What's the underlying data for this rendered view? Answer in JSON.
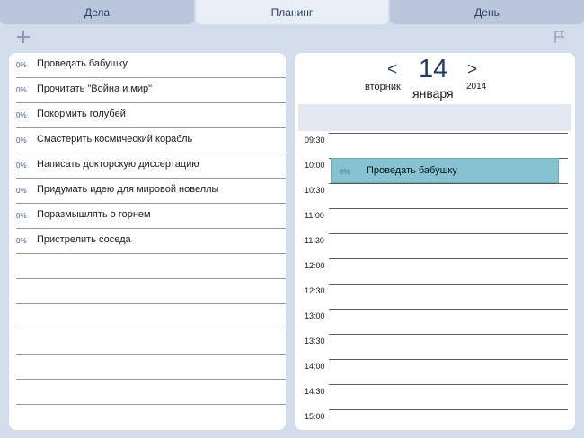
{
  "tabs": [
    {
      "label": "Дела"
    },
    {
      "label": "Планинг"
    },
    {
      "label": "День"
    }
  ],
  "tasks": [
    {
      "percent": "0%",
      "title": "Проведать бабушку"
    },
    {
      "percent": "0%",
      "title": "Прочитать \"Война и мир\""
    },
    {
      "percent": "0%",
      "title": "Покормить голубей"
    },
    {
      "percent": "0%",
      "title": "Смастерить космический корабль"
    },
    {
      "percent": "0%",
      "title": "Написать докторскую диссертацию"
    },
    {
      "percent": "0%",
      "title": "Придумать идею для мировой новеллы"
    },
    {
      "percent": "0%",
      "title": "Поразмышлять о горнем"
    },
    {
      "percent": "0%",
      "title": "Пристрелить соседа"
    }
  ],
  "calendar": {
    "prev": "<",
    "next": ">",
    "day": "14",
    "weekday": "вторник",
    "month": "января",
    "year": "2014",
    "times": [
      "09:30",
      "10:00",
      "10:30",
      "11:00",
      "11:30",
      "12:00",
      "12:30",
      "13:00",
      "13:30",
      "14:00",
      "14:30",
      "15:00"
    ],
    "event": {
      "percent": "0%",
      "title": "Проведать бабушку"
    }
  },
  "icons": {
    "add": "plus-icon",
    "flag": "flag-icon"
  },
  "colors": {
    "accent": "#2b3d66",
    "event": "#86c3d2",
    "background": "#d3dceb"
  }
}
